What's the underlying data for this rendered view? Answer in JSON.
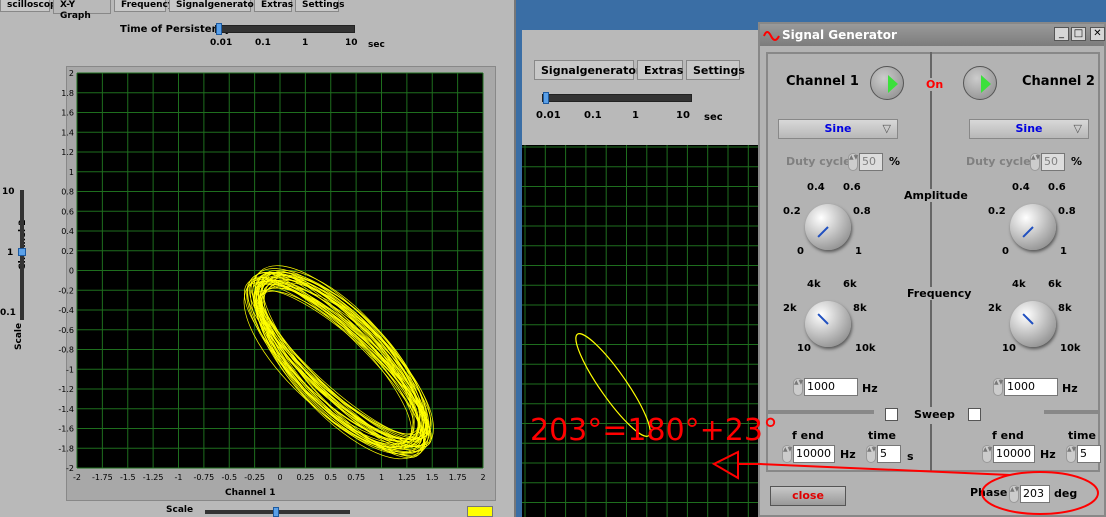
{
  "left": {
    "tabs": [
      "scilloscope",
      "X-Y Graph",
      "Frequency",
      "Signalgenerator",
      "Extras",
      "Settings"
    ],
    "persistence_label": "Time of Persistency",
    "persistence_ticks": [
      "0.01",
      "0.1",
      "1",
      "10"
    ],
    "persistence_unit": "sec",
    "x_ticks": [
      "-2",
      "-1.75",
      "-1.5",
      "-1.25",
      "-1",
      "-0.75",
      "-0.5",
      "-0.25",
      "0",
      "0.25",
      "0.5",
      "0.75",
      "1",
      "1.25",
      "1.5",
      "1.75",
      "2"
    ],
    "y_ticks": [
      "2",
      "1.8",
      "1.6",
      "1.4",
      "1.2",
      "1",
      "0.8",
      "0.6",
      "0.4",
      "0.2",
      "0",
      "-0.2",
      "-0.4",
      "-0.6",
      "-0.8",
      "-1",
      "-1.2",
      "-1.4",
      "-1.6",
      "-1.8",
      "-2"
    ],
    "xlabel": "Channel 1",
    "ylabel": "Channel 2",
    "scale_ticks": [
      "10",
      "1",
      "0.1"
    ],
    "scale_label": "Scale",
    "bottom_scale_label": "Scale",
    "trace_color": "#ffff00"
  },
  "middle": {
    "tabs": [
      "Signalgenerator",
      "Extras",
      "Settings"
    ],
    "persistence_ticks": [
      "0.01",
      "0.1",
      "1",
      "10"
    ],
    "persistence_unit": "sec"
  },
  "sg": {
    "title": "Signal Generator",
    "ch1": "Channel 1",
    "ch2": "Channel 2",
    "on": "On",
    "wave1": "Sine",
    "wave2": "Sine",
    "duty_label": "Duty cycle",
    "duty1": "50",
    "duty2": "50",
    "pct": "%",
    "amplitude": "Amplitude",
    "amp_ticks": [
      "0.4",
      "0.6",
      "0.2",
      "0.8",
      "0",
      "1"
    ],
    "frequency": "Frequency",
    "freq_ticks": [
      "4k",
      "6k",
      "2k",
      "8k",
      "10",
      "10k"
    ],
    "freq1": "1000",
    "freq2": "1000",
    "hz": "Hz",
    "sweep": "Sweep",
    "fend_label": "f end",
    "time_label": "time",
    "fend1": "10000",
    "fend2": "10000",
    "time1": "5",
    "time2": "5",
    "s": "s",
    "close": "close",
    "phase_label": "Phase",
    "phase": "203",
    "deg": "deg"
  },
  "annotation": "203°=180°+23°"
}
